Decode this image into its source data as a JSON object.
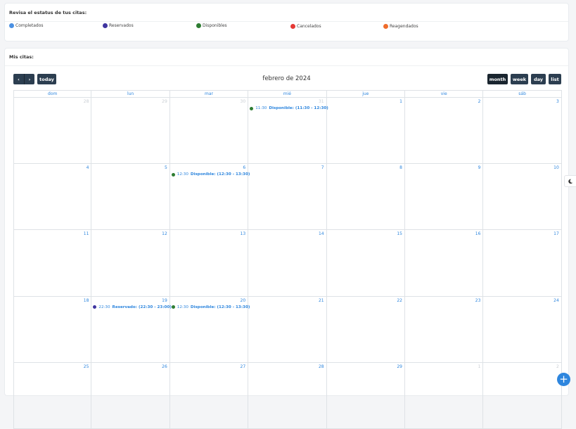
{
  "status": {
    "title": "Revisa el estatus de tus citas:",
    "legend": [
      {
        "label": "Completados",
        "color": "#4a90e2"
      },
      {
        "label": "Reservados",
        "color": "#3f35a0"
      },
      {
        "label": "Disponibles",
        "color": "#2e7d32"
      },
      {
        "label": "Cancelados",
        "color": "#e53935"
      },
      {
        "label": "Reagendados",
        "color": "#ef6c2c"
      }
    ]
  },
  "calendar": {
    "card_title": "Mis citas:",
    "title": "febrero de 2024",
    "prev_label": "‹",
    "next_label": "›",
    "today_label": "today",
    "views": {
      "month": "month",
      "week": "week",
      "day": "day",
      "list": "list"
    },
    "weekdays": [
      "dom",
      "lun",
      "mar",
      "mié",
      "jue",
      "vie",
      "sáb"
    ],
    "weeks": [
      [
        "28",
        "29",
        "30",
        "31",
        "1",
        "2",
        "3"
      ],
      [
        "4",
        "5",
        "6",
        "7",
        "8",
        "9",
        "10"
      ],
      [
        "11",
        "12",
        "13",
        "14",
        "15",
        "16",
        "17"
      ],
      [
        "18",
        "19",
        "20",
        "21",
        "22",
        "23",
        "24"
      ],
      [
        "25",
        "26",
        "27",
        "28",
        "29",
        "1",
        "2"
      ]
    ],
    "events": [
      {
        "week": 0,
        "day": 3,
        "time": "11:30",
        "title": "Disponible: (11:30 - 12:30)",
        "color": "#2e7d32"
      },
      {
        "week": 1,
        "day": 2,
        "time": "12:30",
        "title": "Disponible: (12:30 - 13:30)",
        "color": "#2e7d32"
      },
      {
        "week": 3,
        "day": 1,
        "time": "22:30",
        "title": "Reservado: (22:30 - 23:00)",
        "color": "#3f35a0"
      },
      {
        "week": 3,
        "day": 2,
        "time": "12:30",
        "title": "Disponible: (12:30 - 13:30)",
        "color": "#2e7d32"
      }
    ]
  },
  "theme_toggle_icon": "moon-icon",
  "fab_icon": "plus-icon"
}
